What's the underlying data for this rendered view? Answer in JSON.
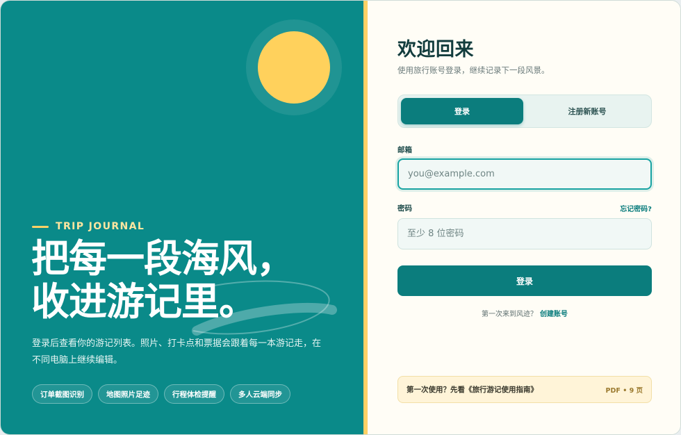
{
  "hero": {
    "eyebrow": "TRIP JOURNAL",
    "headline_line1": "把每一段海风，",
    "headline_line2": "收进游记里。",
    "description": "登录后查看你的游记列表。照片、打卡点和票据会跟着每一本游记走，在不同电脑上继续编辑。",
    "chips": [
      "订单截图识别",
      "地图照片足迹",
      "行程体检提醒",
      "多人云端同步"
    ]
  },
  "login": {
    "title": "欢迎回来",
    "subtitle": "使用旅行账号登录，继续记录下一段风景。",
    "tabs": [
      {
        "label": "登录",
        "active": true
      },
      {
        "label": "注册新账号",
        "active": false
      }
    ],
    "email": {
      "label": "邮箱",
      "value": "",
      "placeholder": "you@example.com"
    },
    "password": {
      "label": "密码",
      "value": "",
      "placeholder": "至少 8 位密码",
      "forgot": "忘记密码?"
    },
    "submit_label": "登录",
    "signup_prompt": "第一次来到风迹？",
    "signup_link": "创建账号",
    "guide": {
      "text": "第一次使用？先看《旅行游记使用指南》",
      "meta": "PDF • 9 页"
    }
  },
  "colors": {
    "teal": "#0a8a89",
    "accent_yellow": "#ffd166",
    "primary_button": "#0b7d7d",
    "title": "#123c3d"
  }
}
